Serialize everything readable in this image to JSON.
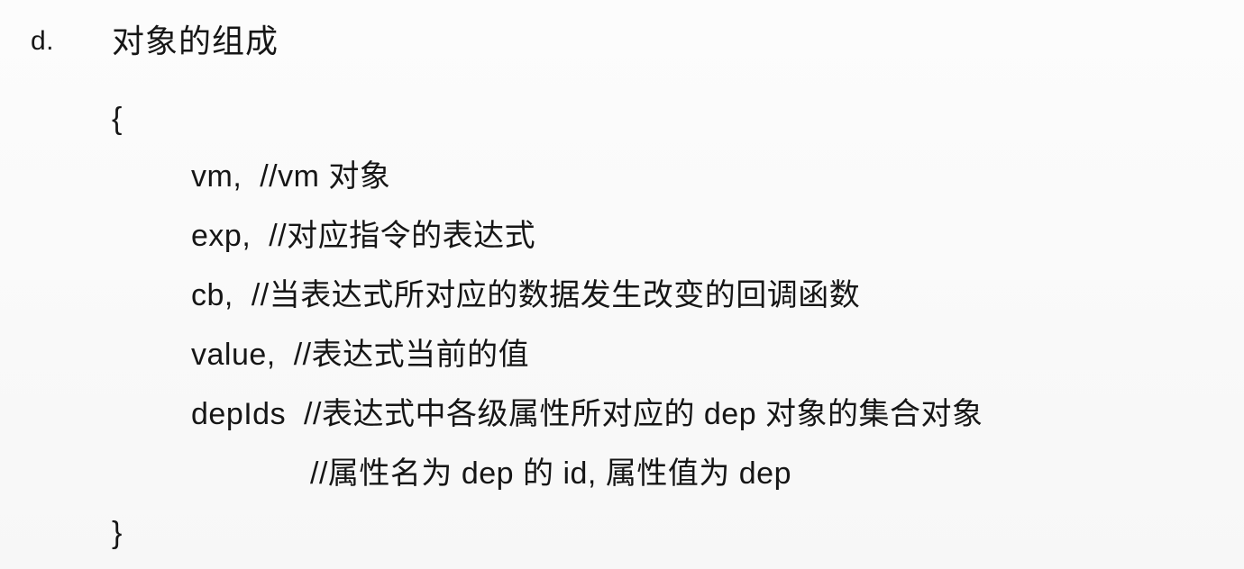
{
  "section": {
    "marker": "d.",
    "title": "对象的组成"
  },
  "braces": {
    "open": "{",
    "close": "}"
  },
  "fields": [
    {
      "code": "vm,",
      "comment": "//vm 对象"
    },
    {
      "code": "exp,",
      "comment": "//对应指令的表达式"
    },
    {
      "code": "cb,",
      "comment": "//当表达式所对应的数据发生改变的回调函数"
    },
    {
      "code": "value,",
      "comment": "//表达式当前的值"
    },
    {
      "code": "depIds",
      "comment": "//表达式中各级属性所对应的 dep 对象的集合对象"
    }
  ],
  "continuation_comment": "//属性名为 dep 的 id, 属性值为 dep"
}
